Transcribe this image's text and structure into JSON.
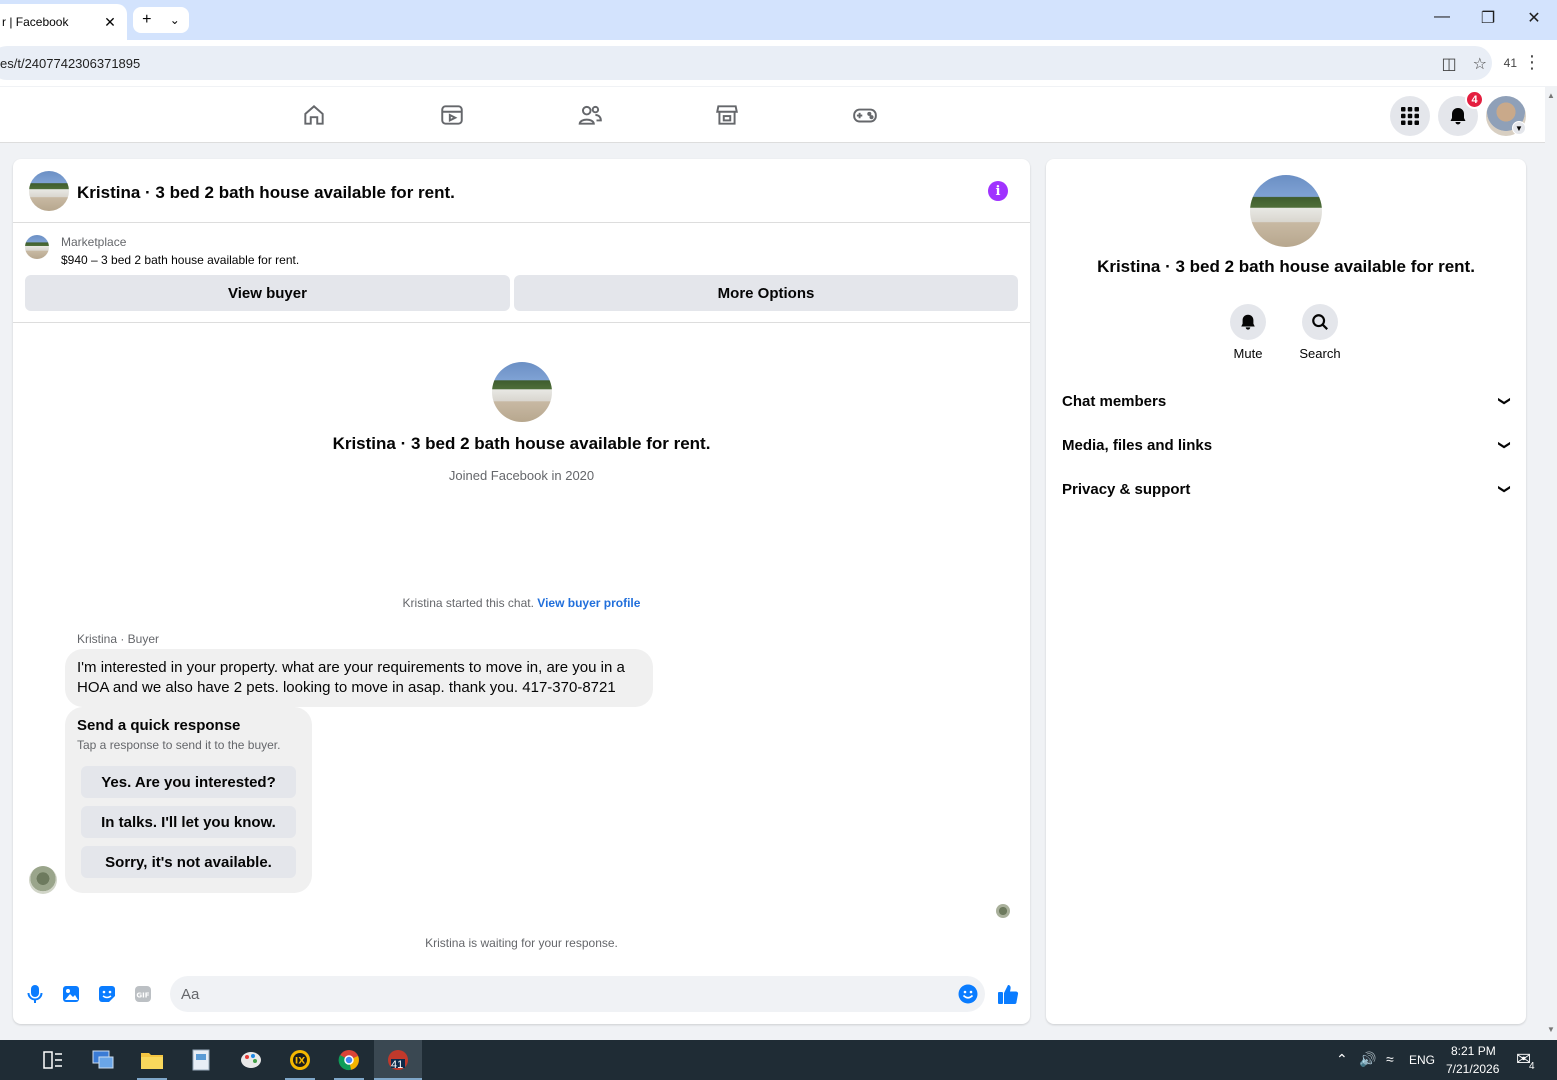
{
  "browser": {
    "tab_title": "r | Facebook",
    "tab_close": "✕",
    "new_tab": "+",
    "tab_dropdown": "⌄",
    "url": "es/t/2407742306371895",
    "extensions_count": "41"
  },
  "fbnav": {
    "notification_count": "4"
  },
  "chat": {
    "title": "Kristina · 3 bed 2 bath house available for rent.",
    "marketplace_label": "Marketplace",
    "listing": "$940 – 3 bed 2 bath house available for rent.",
    "view_buyer": "View buyer",
    "more_options": "More Options",
    "profile_name": "Kristina · 3 bed 2 bath house available for rent.",
    "joined": "Joined Facebook in 2020",
    "started_text": "Kristina started this chat.",
    "started_link": "View buyer profile",
    "sender": "Kristina · Buyer",
    "message": "I'm interested in your property. what are your requirements to move in, are you in a HOA and we also have 2 pets. looking to move in asap. thank you. 417-370-8721",
    "quick_title": "Send a quick response",
    "quick_subtitle": "Tap a response to send it to the buyer.",
    "quick_responses": [
      "Yes. Are you interested?",
      "In talks. I'll let you know.",
      "Sorry, it's not available."
    ],
    "waiting": "Kristina is waiting for your response.",
    "input_placeholder": "Aa"
  },
  "info_panel": {
    "name": "Kristina · 3 bed 2 bath house available for rent.",
    "mute_label": "Mute",
    "search_label": "Search",
    "sections": [
      "Chat members",
      "Media, files and links",
      "Privacy & support"
    ]
  },
  "taskbar": {
    "chrome_badge": "41",
    "language": "ENG",
    "time": "8:21 PM",
    "date": "7/21/2026",
    "notif_count": "4"
  },
  "colors": {
    "accent": "#0a7cff",
    "link": "#216fdb",
    "info": "#a033ff",
    "badge": "#e41e3f"
  }
}
